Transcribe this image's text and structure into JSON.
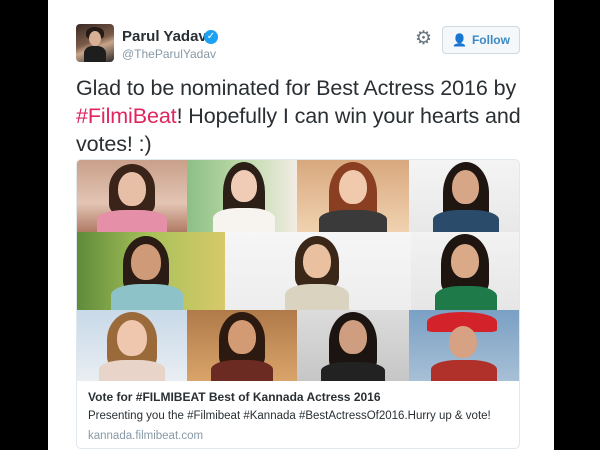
{
  "user": {
    "name": "Parul Yadav",
    "handle": "@TheParulYadav",
    "verified_icon": "verified-badge-icon"
  },
  "actions": {
    "settings_icon": "gear-icon",
    "follow_label": "Follow",
    "follow_icon": "person-add-icon"
  },
  "tweet": {
    "text_before": "Glad to be nominated for Best Actress 2016 by ",
    "hashtag": "#FilmiBeat",
    "text_after": "! Hopefully I can win your hearts and votes! :)",
    "hashtag_color": "#e0245e"
  },
  "card": {
    "title": "Vote for #FILMIBEAT Best of Kannada Actress 2016",
    "description": "Presenting you the #Filmibeat #Kannada #BestActressOf2016.Hurry up & vote!",
    "domain": "kannada.filmibeat.com"
  },
  "colors": {
    "accent": "#1da1f2",
    "follow_text": "#3b88c3"
  }
}
